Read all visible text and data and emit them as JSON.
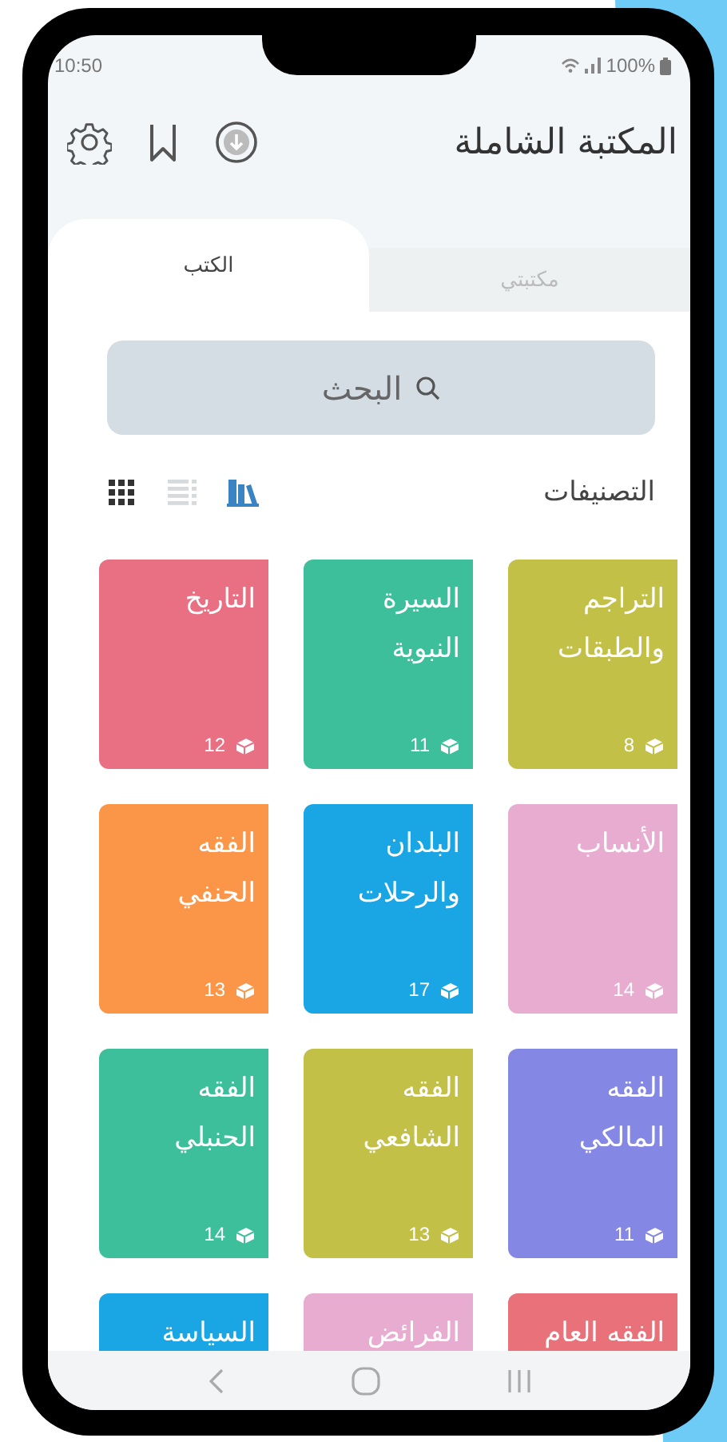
{
  "status_bar": {
    "time": "10:50",
    "battery": "100%"
  },
  "header": {
    "title": "المكتبة الشاملة"
  },
  "tabs": [
    {
      "label": "مكتبتي",
      "selected": false
    },
    {
      "label": "الكتب",
      "selected": true
    }
  ],
  "search": {
    "placeholder": "البحث"
  },
  "section": {
    "title": "التصنيفات"
  },
  "view_modes": [
    {
      "kind": "shelf",
      "selected": true
    },
    {
      "kind": "list",
      "selected": false
    },
    {
      "kind": "grid",
      "selected": false
    }
  ],
  "categories": [
    {
      "title": "التراجم والطبقات",
      "count": "8",
      "color": "#c3c048"
    },
    {
      "title": "السيرة النبوية",
      "count": "11",
      "color": "#3dbf9c"
    },
    {
      "title": "التاريخ",
      "count": "12",
      "color": "#e96f83"
    },
    {
      "title": "الأنساب",
      "count": "14",
      "color": "#e8acd0"
    },
    {
      "title": "البلدان والرحلات",
      "count": "17",
      "color": "#1aa6e4"
    },
    {
      "title": "الفقه الحنفي",
      "count": "13",
      "color": "#fb9648"
    },
    {
      "title": "الفقه المالكي",
      "count": "11",
      "color": "#8487e3"
    },
    {
      "title": "الفقه الشافعي",
      "count": "13",
      "color": "#c3c048"
    },
    {
      "title": "الفقه الحنبلي",
      "count": "14",
      "color": "#3dbf9c"
    },
    {
      "title": "الفقه العام",
      "color": "#e9717a"
    },
    {
      "title": "الفرائض",
      "color": "#e8acd0"
    },
    {
      "title": "السياسة",
      "color": "#1aa6e4"
    }
  ]
}
